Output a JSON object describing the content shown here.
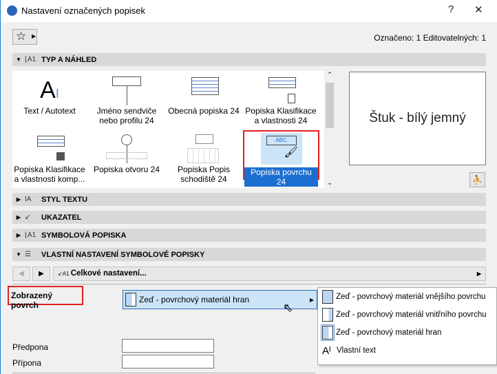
{
  "window": {
    "title": "Nastavení označených popisek",
    "help": "?",
    "close": "✕"
  },
  "status": "Označeno: 1 Editovatelných: 1",
  "sections": {
    "type_preview": "TYP A NÁHLED",
    "text_style": "STYL TEXTU",
    "pointer": "UKAZATEL",
    "symbol_label": "SYMBOLOVÁ POPISKA",
    "custom_settings": "VLASTNÍ NASTAVENÍ SYMBOLOVÉ POPISKY"
  },
  "gallery": [
    {
      "label": "Text / Autotext",
      "icon": "autotext-icon"
    },
    {
      "label": "Jméno sendviče nebo profilu 24",
      "icon": "composite-name-icon"
    },
    {
      "label": "Obecná popiska 24",
      "icon": "general-label-icon"
    },
    {
      "label": "Popiska Klasifikace a vlastnosti 24",
      "icon": "classification-icon"
    },
    {
      "label": "Popiska Klasifikace a vlastnosti komp...",
      "icon": "classification-component-icon"
    },
    {
      "label": "Popiska otvoru 24",
      "icon": "opening-label-icon"
    },
    {
      "label": "Popiska Popis schodiště 24",
      "icon": "stair-label-icon"
    },
    {
      "label": "Popiska povrchu 24",
      "icon": "surface-label-icon",
      "selected": true
    }
  ],
  "preview_text": "Štuk - bílý jemný",
  "nav": {
    "page": "Celkové nastavení..."
  },
  "surface": {
    "label": "Zobrazený povrch",
    "value": "Zeď - povrchový materiál hran",
    "options": [
      {
        "label": "Zeď - povrchový materiál vnějšího povrchu",
        "icon": "wall-outside-icon"
      },
      {
        "label": "Zeď - povrchový materiál vnitřního povrchu",
        "icon": "wall-inside-icon"
      },
      {
        "label": "Zeď - povrchový materiál hran",
        "icon": "wall-edge-icon",
        "selected": true
      },
      {
        "label": "Vlastní text",
        "icon": "custom-text-icon"
      }
    ]
  },
  "fields": {
    "prefix_label": "Předpona",
    "prefix_value": "",
    "suffix_label": "Přípona",
    "suffix_value": ""
  },
  "colors": {
    "accent": "#1c6fd0",
    "highlight": "#e02020",
    "selection_bg": "#cce4f7"
  }
}
